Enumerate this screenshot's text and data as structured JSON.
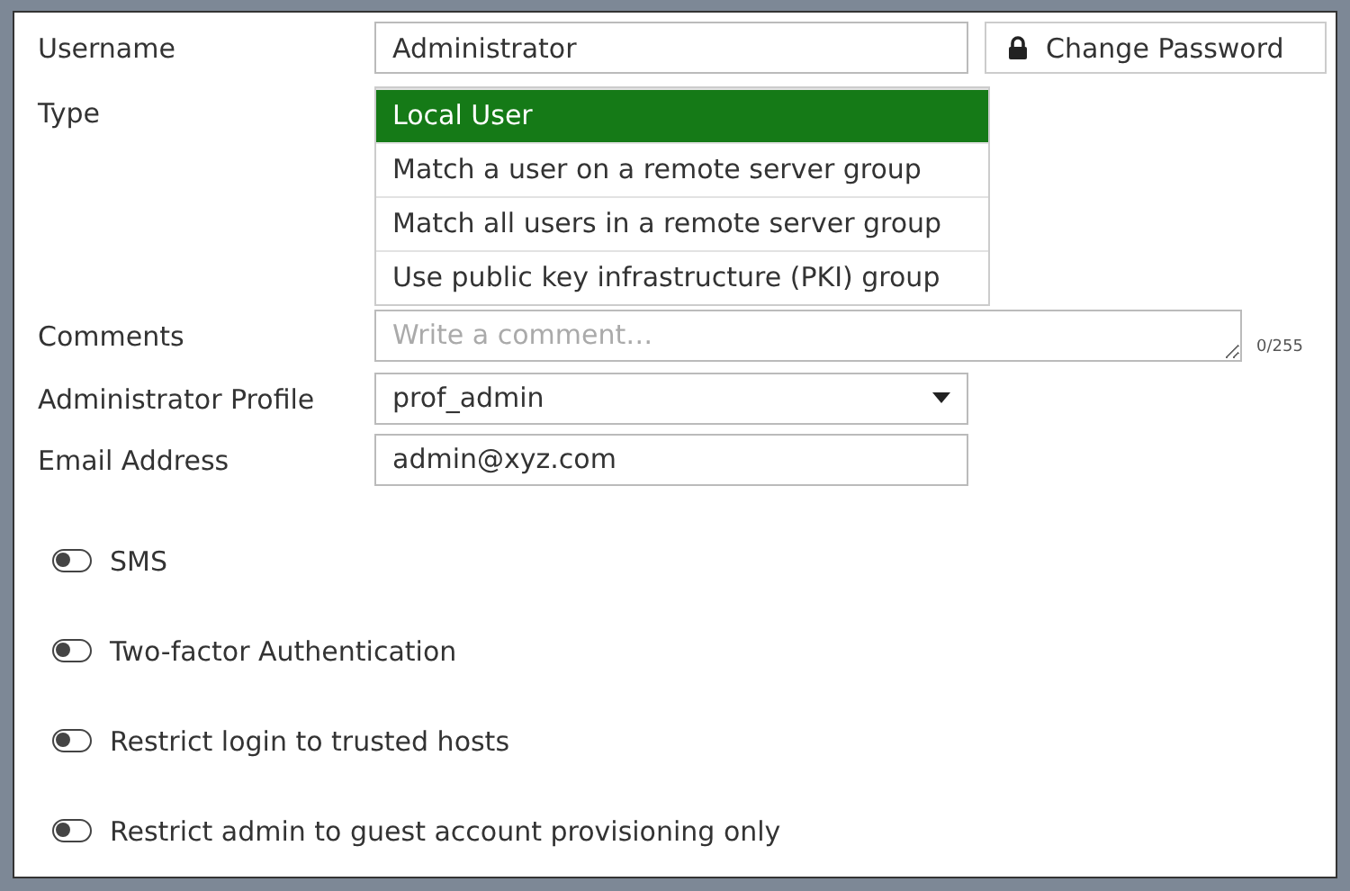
{
  "username": {
    "label": "Username",
    "value": "Administrator"
  },
  "change_password": {
    "label": "Change Password"
  },
  "type": {
    "label": "Type",
    "options": [
      {
        "label": "Local User",
        "selected": true
      },
      {
        "label": "Match a user on a remote server group",
        "selected": false
      },
      {
        "label": "Match all users in a remote server group",
        "selected": false
      },
      {
        "label": "Use public key infrastructure (PKI) group",
        "selected": false
      }
    ]
  },
  "comments": {
    "label": "Comments",
    "placeholder": "Write a comment…",
    "counter": "0/255"
  },
  "profile": {
    "label": "Administrator Profile",
    "value": "prof_admin"
  },
  "email": {
    "label": "Email Address",
    "value": "admin@xyz.com"
  },
  "toggles": [
    {
      "label": "SMS",
      "on": false
    },
    {
      "label": "Two-factor Authentication",
      "on": false
    },
    {
      "label": "Restrict login to trusted hosts",
      "on": false
    },
    {
      "label": "Restrict admin to guest account provisioning only",
      "on": false
    }
  ]
}
